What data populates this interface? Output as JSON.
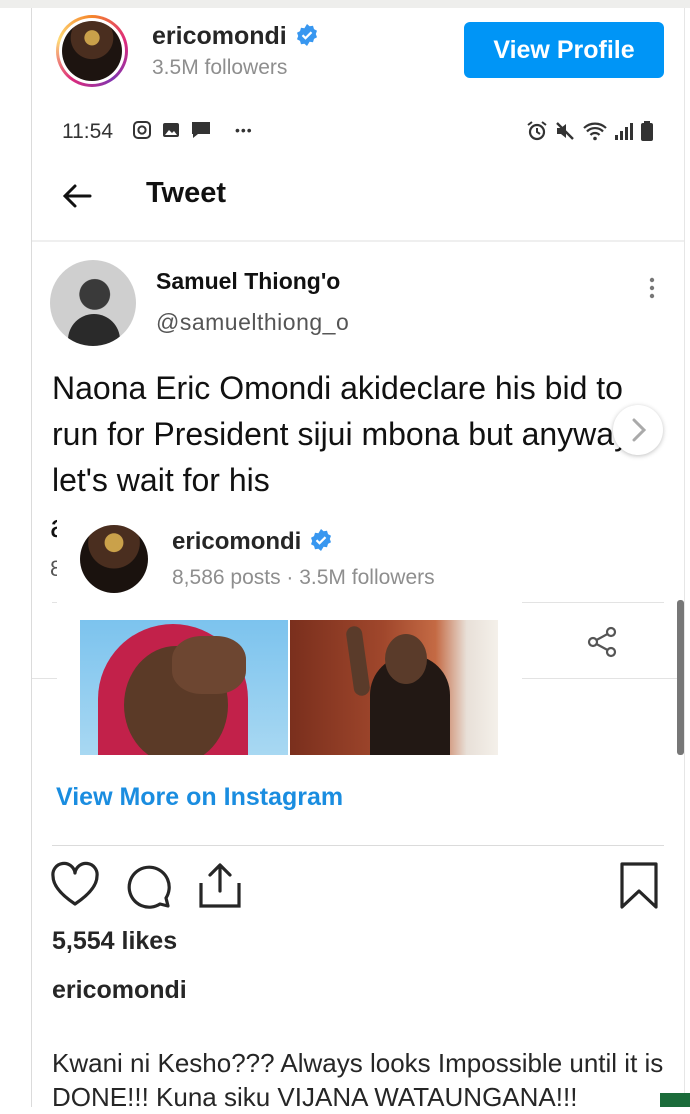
{
  "instagram_header": {
    "username": "ericomondi",
    "followers": "3.5M followers",
    "view_profile_label": "View Profile"
  },
  "tweet_screenshot": {
    "status_time": "11:54",
    "status_overflow": "•••",
    "header_title": "Tweet",
    "author_name": "Samuel Thiong'o",
    "author_handle": "@samuelthiong_o",
    "body": "Naona Eric Omondi akideclare his bid to run for President sijui mbona but anyways let's wait for his",
    "partial_line": "a",
    "partial_meta": "8"
  },
  "embed_card": {
    "username": "ericomondi",
    "meta": "8,586 posts · 3.5M followers"
  },
  "view_more_label": "View More on Instagram",
  "post": {
    "likes": "5,554 likes",
    "username": "ericomondi",
    "caption": "Kwani ni Kesho??? Always looks Impossible until it is DONE!!! Kuna siku VIJANA WATAUNGANA!!!"
  },
  "icons": [
    "verified-badge-icon",
    "instagram-icon",
    "image-icon",
    "message-icon",
    "alarm-icon",
    "mute-icon",
    "wifi-icon",
    "signal-icon",
    "battery-icon",
    "back-arrow-icon",
    "more-vertical-icon",
    "chevron-right-icon",
    "share-icon",
    "heart-icon",
    "comment-icon",
    "upload-icon",
    "bookmark-icon"
  ],
  "colors": {
    "accent": "#0095f6",
    "link": "#1a8de0",
    "verified": "#3897f0",
    "muted": "#8e8e8e"
  }
}
